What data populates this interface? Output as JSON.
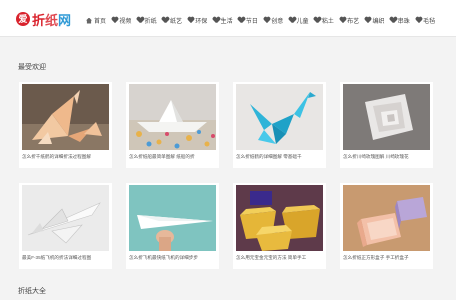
{
  "site": {
    "logo_char": "爱",
    "logo_word1": "折",
    "logo_word2": "纸",
    "logo_word3": "网"
  },
  "nav": [
    {
      "label": "首页"
    },
    {
      "label": "视频"
    },
    {
      "label": "折纸"
    },
    {
      "label": "纸艺"
    },
    {
      "label": "环保"
    },
    {
      "label": "生活"
    },
    {
      "label": "节日"
    },
    {
      "label": "创意"
    },
    {
      "label": "儿童"
    },
    {
      "label": "粘土"
    },
    {
      "label": "布艺"
    },
    {
      "label": "编织"
    },
    {
      "label": "串珠"
    },
    {
      "label": "毛毡"
    }
  ],
  "popular": {
    "title": "最受欢迎",
    "items": [
      {
        "caption": "怎么折千纸鹤的详细折法过程图解",
        "thumb": "crane-set"
      },
      {
        "caption": "怎么折纸船最简单图解 纸船的折",
        "thumb": "boat"
      },
      {
        "caption": "怎么折纸鹤的详细图解 零基础千",
        "thumb": "blue-crane"
      },
      {
        "caption": "怎么折川崎玫瑰图解 川崎玫瑰花",
        "thumb": "rose"
      },
      {
        "caption": "最美F-35纸飞机的折法详细过程图",
        "thumb": "jet"
      },
      {
        "caption": "怎么折飞机最快纸飞机的详细步步",
        "thumb": "plane"
      },
      {
        "caption": "怎么用元宝金元宝的方法 简单手工",
        "thumb": "ingots"
      },
      {
        "caption": "怎么折纸正方形盒子 手工折盒子",
        "thumb": "boxes"
      }
    ]
  },
  "all": {
    "title": "折纸大全"
  },
  "colors": {
    "brand": "#d9232d",
    "accent_blue": "#2f9ad6"
  }
}
